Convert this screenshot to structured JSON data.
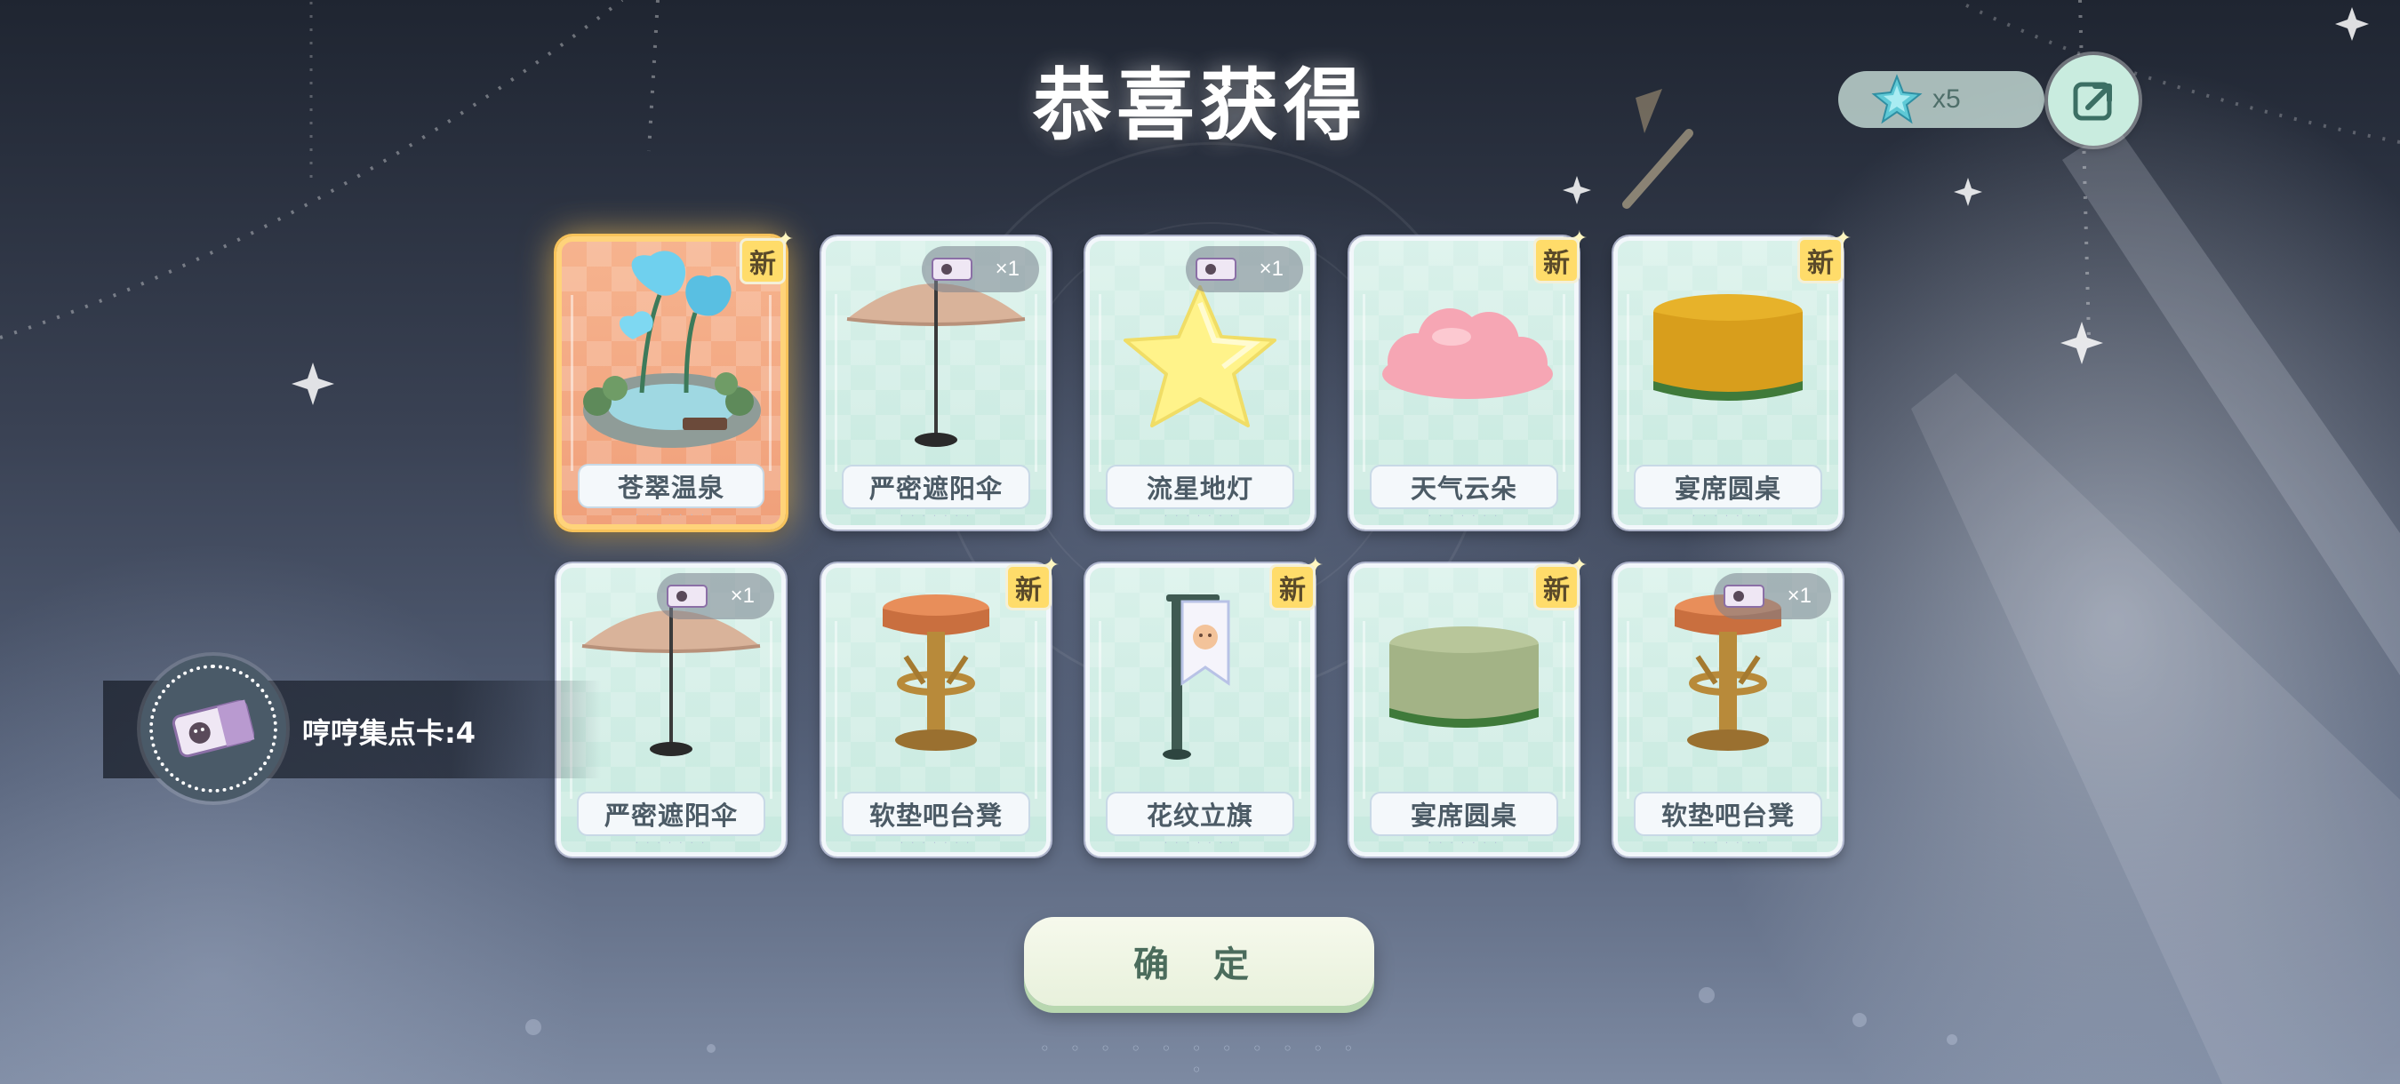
{
  "title": "恭喜获得",
  "currency": {
    "icon": "star-gem-icon",
    "count": "x5"
  },
  "share": {
    "icon": "share-icon"
  },
  "stamp_card": {
    "label": "哼哼集点卡:4",
    "icon": "ticket-icon"
  },
  "confirm_label": "确 定",
  "rewards": [
    {
      "name": "苍翠温泉",
      "badge": "新",
      "highlight": true,
      "art": "hot-spring"
    },
    {
      "name": "严密遮阳伞",
      "badge": "×1",
      "art": "umbrella"
    },
    {
      "name": "流星地灯",
      "badge": "×1",
      "art": "star-lamp"
    },
    {
      "name": "天气云朵",
      "badge": "新",
      "art": "cloud"
    },
    {
      "name": "宴席圆桌",
      "badge": "新",
      "art": "yellow-table"
    },
    {
      "name": "严密遮阳伞",
      "badge": "×1",
      "art": "umbrella"
    },
    {
      "name": "软垫吧台凳",
      "badge": "新",
      "art": "bar-stool"
    },
    {
      "name": "花纹立旗",
      "badge": "新",
      "art": "flag"
    },
    {
      "name": "宴席圆桌",
      "badge": "新",
      "art": "green-table"
    },
    {
      "name": "软垫吧台凳",
      "badge": "×1",
      "art": "bar-stool"
    }
  ],
  "colors": {
    "card_bg": "#c7e9df",
    "gold_border": "#ffd37a",
    "new_badge": "#ffdc6a",
    "confirm_text": "#4b6c5c"
  }
}
